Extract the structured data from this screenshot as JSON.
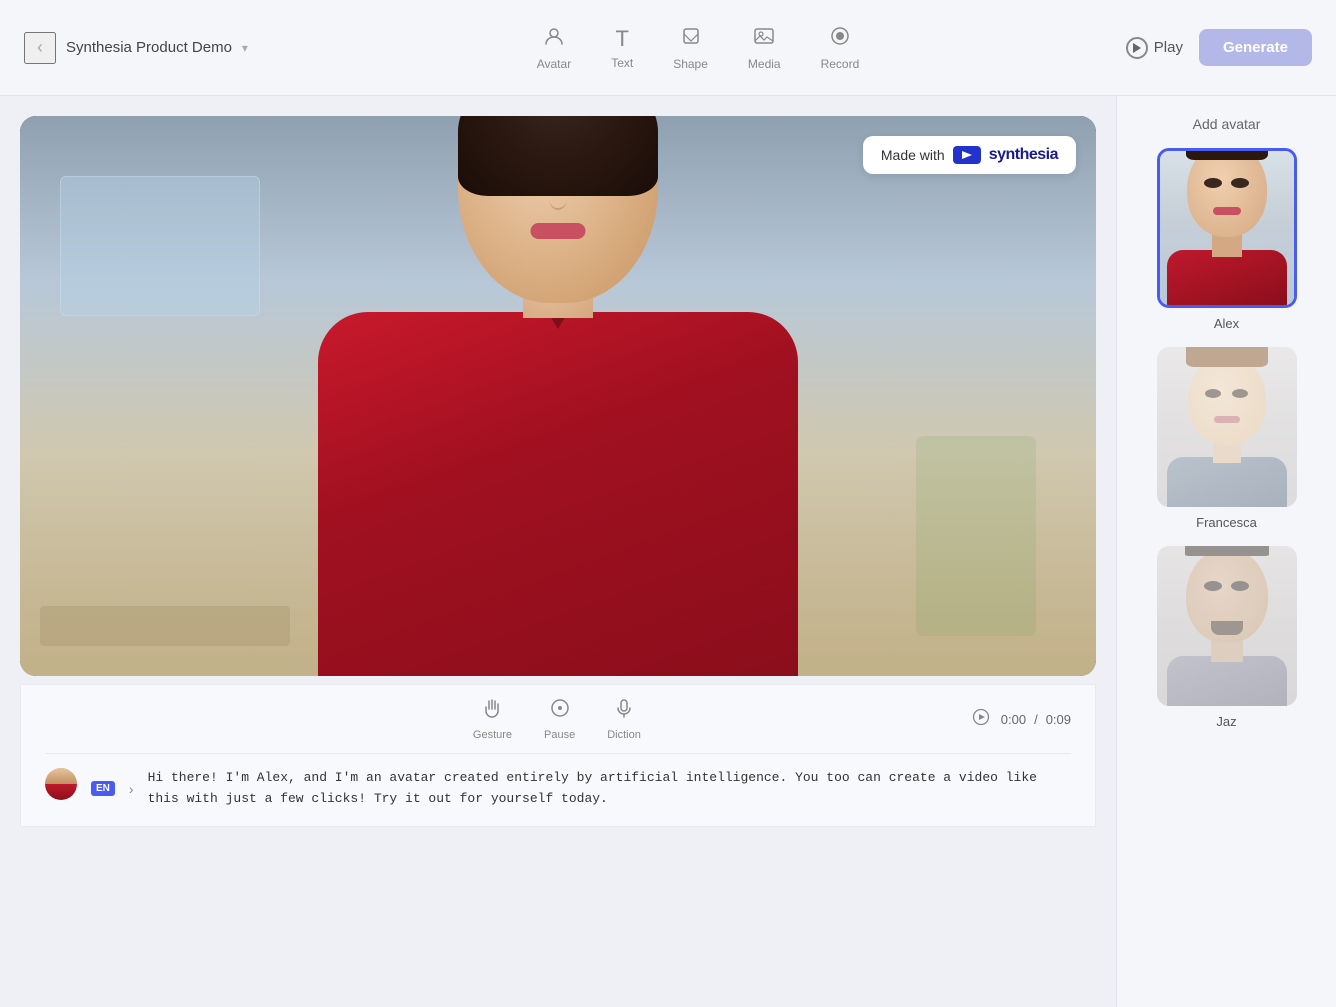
{
  "toolbar": {
    "back_label": "‹",
    "project_name": "Synthesia Product Demo",
    "dropdown_icon": "▾",
    "tools": [
      {
        "id": "avatar",
        "label": "Avatar",
        "icon": "👤"
      },
      {
        "id": "text",
        "label": "Text",
        "icon": "T"
      },
      {
        "id": "shape",
        "label": "Shape",
        "icon": "⬜"
      },
      {
        "id": "media",
        "label": "Media",
        "icon": "🖼"
      },
      {
        "id": "record",
        "label": "Record",
        "icon": "⏺"
      }
    ],
    "play_label": "Play",
    "generate_label": "Generate"
  },
  "video": {
    "watermark": {
      "made_with_label": "Made with",
      "brand_name": "synthesia"
    }
  },
  "controls": {
    "gesture_label": "Gesture",
    "pause_label": "Pause",
    "diction_label": "Diction",
    "time_current": "0:00",
    "time_total": "0:09",
    "time_separator": "/"
  },
  "script": {
    "lang_badge": "EN",
    "text": "Hi there! I'm Alex, and I'm an avatar created entirely by\nartificial intelligence. You too can create a video like this with\njust a few clicks! Try it out for yourself today."
  },
  "sidebar": {
    "title": "Add avatar",
    "avatars": [
      {
        "id": "alex",
        "name": "Alex",
        "selected": true
      },
      {
        "id": "francesca",
        "name": "Francesca",
        "selected": false
      },
      {
        "id": "jaz",
        "name": "Jaz",
        "selected": false
      }
    ]
  }
}
